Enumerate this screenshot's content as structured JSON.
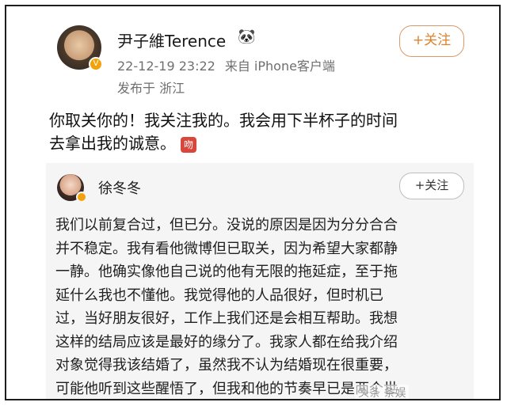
{
  "post": {
    "user_name": "尹子維Terence",
    "name_emoji": "🐼",
    "verified_badge": "V",
    "timestamp": "22-12-19 23:22",
    "source": "来自 iPhone客户端",
    "location": "发布于 浙江",
    "follow_label": "+关注",
    "text_line1": "你取关你的！我关注我的。我会用下半杯子的时间",
    "text_line2": "去拿出我的诚意。",
    "emoji_tag": "吻"
  },
  "repost": {
    "user_name": "徐冬冬",
    "follow_label": "+关注",
    "lines": [
      "我们以前复合过，但已分。没说的原因是因为分分合合",
      "并不稳定。我有看他微博但已取关，因为希望大家都静",
      "一静。他确实像他自己说的他有无限的拖延症，至于拖",
      "延什么我也不懂他。我觉得他的人品很好，但时机已",
      "过，当好朋友很好，工作上我们还是会相互帮助。我想",
      "这样的结局应该是最好的缘分了。我家人都在给我介绍",
      "对象觉得我该结婚了，虽然我不认为结婚现在很重要，",
      "可能他听到这些醒悟了，但我和他的节奏早已是两个世"
    ]
  },
  "watermark": "头条 条娱",
  "colors": {
    "accent_follow": "#e0812c",
    "verified": "#f2a20a",
    "repost_bg": "#f5f5f5"
  }
}
